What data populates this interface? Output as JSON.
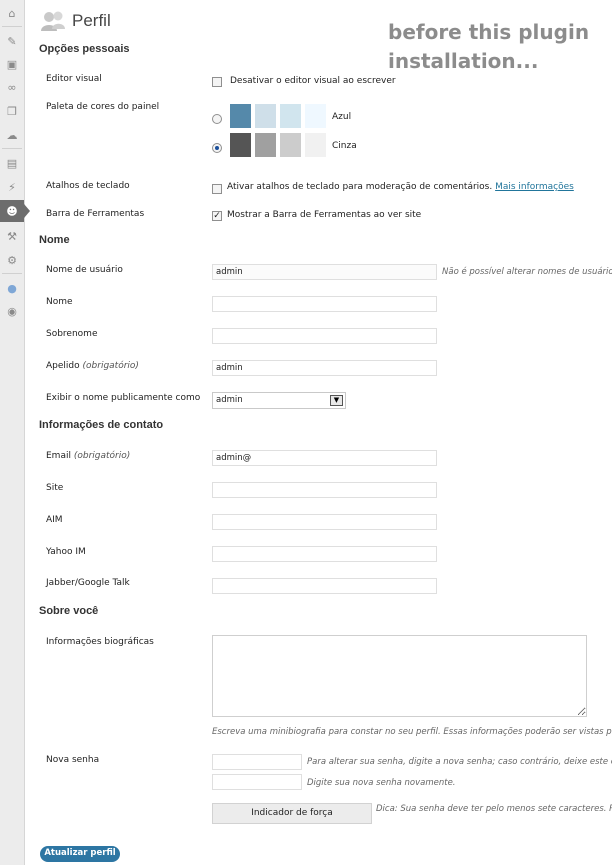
{
  "page": {
    "title": "Perfil"
  },
  "annotation": {
    "line1": "before this plugin",
    "line2": "installation..."
  },
  "sidebar": {
    "icons": [
      "dashboard-icon",
      "pin-icon",
      "media-icon",
      "links-icon",
      "pages-icon",
      "comments-icon",
      "appearance-icon",
      "plugins-icon",
      "users-icon",
      "tools-icon",
      "settings-icon",
      "extra-plugin-icon",
      "collapse-icon"
    ]
  },
  "personal": {
    "heading": "Opções pessoais",
    "visual_editor": {
      "label": "Editor visual",
      "checkbox_label": "Desativar o editor visual ao escrever",
      "checked": false
    },
    "admin_color": {
      "label": "Paleta de cores do painel",
      "options": [
        {
          "name": "Azul",
          "selected": false,
          "colors": [
            "#5589aa",
            "#cfdfe9",
            "#d1e5ee",
            "#eff8ff"
          ]
        },
        {
          "name": "Cinza",
          "selected": true,
          "colors": [
            "#555555",
            "#a0a0a0",
            "#cccccc",
            "#f1f1f1"
          ]
        }
      ]
    },
    "shortcuts": {
      "label": "Atalhos de teclado",
      "checkbox_label": "Ativar atalhos de teclado para moderação de comentários.",
      "link": "Mais informações",
      "checked": false
    },
    "toolbar": {
      "label": "Barra de Ferramentas",
      "checkbox_label": "Mostrar a Barra de Ferramentas ao ver site",
      "checked": true
    }
  },
  "name": {
    "heading": "Nome",
    "username": {
      "label": "Nome de usuário",
      "value": "admin",
      "hint": "Não é possível alterar nomes de usuário."
    },
    "first_name": {
      "label": "Nome",
      "value": ""
    },
    "last_name": {
      "label": "Sobrenome",
      "value": ""
    },
    "nickname": {
      "label": "Apelido",
      "required": "(obrigatório)",
      "value": "admin"
    },
    "display_name": {
      "label": "Exibir o nome publicamente como",
      "value": "admin"
    }
  },
  "contact": {
    "heading": "Informações de contato",
    "email": {
      "label": "Email",
      "required": "(obrigatório)",
      "value": "admin@"
    },
    "site": {
      "label": "Site",
      "value": ""
    },
    "aim": {
      "label": "AIM",
      "value": ""
    },
    "yahoo": {
      "label": "Yahoo IM",
      "value": ""
    },
    "jabber": {
      "label": "Jabber/Google Talk",
      "value": ""
    }
  },
  "about": {
    "heading": "Sobre você",
    "bio": {
      "label": "Informações biográficas",
      "value": "",
      "hint": "Escreva uma minibiografia para constar no seu perfil. Essas informações poderão ser vistas por t"
    },
    "password": {
      "label": "Nova senha",
      "hint1": "Para alterar sua senha, digite a nova senha; caso contrário, deixe este e",
      "hint2": "Digite sua nova senha novamente.",
      "strength": "Indicador de força",
      "tip": "Dica: Sua senha deve ter pelo menos sete caracteres. P"
    }
  },
  "submit": {
    "label": "Atualizar perfil"
  }
}
